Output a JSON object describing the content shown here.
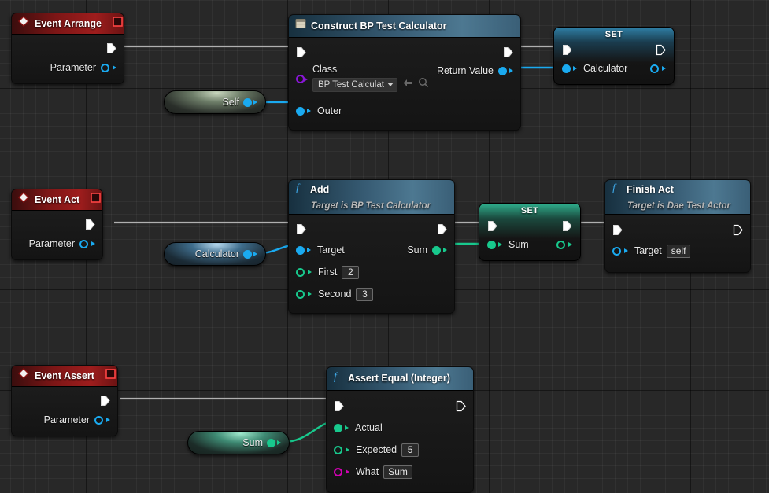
{
  "editor": {
    "name": "unreal-blueprint-graph",
    "background_color": "#282828",
    "grid_minor_color": "#2f2f2f",
    "grid_major_color": "#1a1a1a"
  },
  "palette": {
    "exec_white": "#ffffff",
    "object_blue": "#1aaaf0",
    "class_purple": "#8a16d8",
    "int_green": "#18c98d",
    "string_magenta": "#d400b4",
    "event_red": "#9e1d1d",
    "function_blue": "#4d7891",
    "wire_grey": "#b0b0b0"
  },
  "nodes": [
    {
      "id": "event-arrange",
      "type": "event",
      "title": "Event Arrange",
      "icon": "event-diamond-icon",
      "badge": "delegate-square-icon",
      "pins_out": [
        {
          "name": "exec-out",
          "label": "",
          "kind": "exec"
        },
        {
          "name": "parameter-out",
          "label": "Parameter",
          "kind": "object",
          "color": "#1aaaf0"
        }
      ]
    },
    {
      "id": "construct-bp-test-calculator",
      "type": "function",
      "title": "Construct BP Test Calculator",
      "icon": "construct-box-icon",
      "subtitle": "",
      "pins_in": [
        {
          "name": "exec-in",
          "label": "",
          "kind": "exec"
        },
        {
          "name": "class-in",
          "label": "Class",
          "kind": "class",
          "color": "#8a16d8",
          "widget": {
            "type": "combo",
            "value": "BP Test Calculat",
            "icons": [
              "back-arrow-icon",
              "browse-search-icon"
            ]
          }
        },
        {
          "name": "outer-in",
          "label": "Outer",
          "kind": "object",
          "color": "#1aaaf0"
        }
      ],
      "pins_out": [
        {
          "name": "exec-out",
          "label": "",
          "kind": "exec"
        },
        {
          "name": "return-value-out",
          "label": "Return Value",
          "kind": "object",
          "color": "#1aaaf0"
        }
      ]
    },
    {
      "id": "set-calculator",
      "type": "set",
      "title": "SET",
      "variable": "Calculator",
      "variable_color": "#1aaaf0"
    },
    {
      "id": "self-knot",
      "type": "knot",
      "label": "Self",
      "color": "#1aaaf0"
    },
    {
      "id": "event-act",
      "type": "event",
      "title": "Event Act",
      "icon": "event-diamond-icon",
      "badge": "delegate-square-icon",
      "pins_out": [
        {
          "name": "exec-out",
          "label": "",
          "kind": "exec"
        },
        {
          "name": "parameter-out",
          "label": "Parameter",
          "kind": "object",
          "color": "#1aaaf0"
        }
      ]
    },
    {
      "id": "calculator-knot",
      "type": "knot",
      "label": "Calculator",
      "color": "#1aaaf0"
    },
    {
      "id": "add",
      "type": "function",
      "title": "Add",
      "subtitle": "Target is BP Test Calculator",
      "icon": "function-f-icon",
      "pins_in": [
        {
          "name": "exec-in",
          "label": "",
          "kind": "exec"
        },
        {
          "name": "target-in",
          "label": "Target",
          "kind": "object",
          "color": "#1aaaf0"
        },
        {
          "name": "first-in",
          "label": "First",
          "kind": "int",
          "color": "#18c98d",
          "value": "2"
        },
        {
          "name": "second-in",
          "label": "Second",
          "kind": "int",
          "color": "#18c98d",
          "value": "3"
        }
      ],
      "pins_out": [
        {
          "name": "exec-out",
          "label": "",
          "kind": "exec"
        },
        {
          "name": "sum-out",
          "label": "Sum",
          "kind": "int",
          "color": "#18c98d"
        }
      ]
    },
    {
      "id": "set-sum",
      "type": "set",
      "title": "SET",
      "variable": "Sum",
      "variable_color": "#18c98d"
    },
    {
      "id": "finish-act",
      "type": "function",
      "title": "Finish Act",
      "subtitle": "Target is Dae Test Actor",
      "icon": "function-f-icon",
      "pins_in": [
        {
          "name": "exec-in",
          "label": "",
          "kind": "exec"
        },
        {
          "name": "target-in",
          "label": "Target",
          "kind": "object",
          "color": "#1aaaf0",
          "value": "self"
        }
      ],
      "pins_out": [
        {
          "name": "exec-out",
          "label": "",
          "kind": "exec"
        }
      ]
    },
    {
      "id": "event-assert",
      "type": "event",
      "title": "Event Assert",
      "icon": "event-diamond-icon",
      "badge": "delegate-square-icon",
      "pins_out": [
        {
          "name": "exec-out",
          "label": "",
          "kind": "exec"
        },
        {
          "name": "parameter-out",
          "label": "Parameter",
          "kind": "object",
          "color": "#1aaaf0"
        }
      ]
    },
    {
      "id": "sum-knot",
      "type": "knot",
      "label": "Sum",
      "color": "#18c98d"
    },
    {
      "id": "assert-equal-integer",
      "type": "function",
      "title": "Assert Equal (Integer)",
      "subtitle": "",
      "icon": "function-f-icon",
      "pins_in": [
        {
          "name": "exec-in",
          "label": "",
          "kind": "exec"
        },
        {
          "name": "actual-in",
          "label": "Actual",
          "kind": "int",
          "color": "#18c98d"
        },
        {
          "name": "expected-in",
          "label": "Expected",
          "kind": "int",
          "color": "#18c98d",
          "value": "5"
        },
        {
          "name": "what-in",
          "label": "What",
          "kind": "string",
          "color": "#d400b4",
          "value": "Sum"
        }
      ],
      "pins_out": [
        {
          "name": "exec-out",
          "label": "",
          "kind": "exec"
        }
      ]
    }
  ],
  "labels": {
    "event_arrange": "Event Arrange",
    "event_act": "Event Act",
    "event_assert": "Event Assert",
    "parameter": "Parameter",
    "construct_title": "Construct BP Test Calculator",
    "class": "Class",
    "class_value": "BP Test Calculat",
    "outer": "Outer",
    "return_value": "Return Value",
    "set": "SET",
    "calculator": "Calculator",
    "self": "Self",
    "add_title": "Add",
    "add_subtitle": "Target is BP Test Calculator",
    "target": "Target",
    "first": "First",
    "first_value": "2",
    "second": "Second",
    "second_value": "3",
    "sum": "Sum",
    "finish_act_title": "Finish Act",
    "finish_act_subtitle": "Target is Dae Test Actor",
    "target_self_value": "self",
    "assert_title": "Assert Equal (Integer)",
    "actual": "Actual",
    "expected": "Expected",
    "expected_value": "5",
    "what": "What",
    "what_value": "Sum"
  }
}
